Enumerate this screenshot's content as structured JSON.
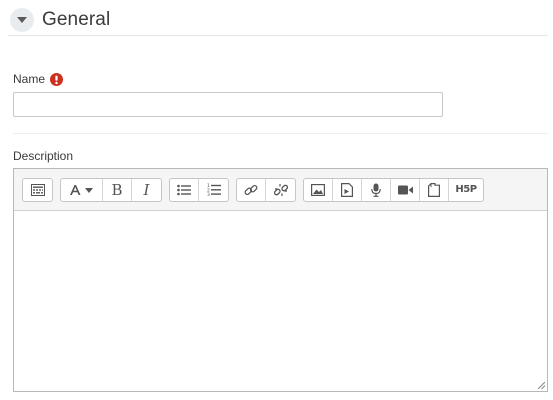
{
  "section": {
    "title": "General",
    "toggle_icon": "chevron-down-icon"
  },
  "fields": {
    "name": {
      "label": "Name",
      "value": "",
      "required": true,
      "required_icon": "exclamation-circle-icon",
      "required_color": "#ca3120"
    },
    "description": {
      "label": "Description",
      "value": ""
    }
  },
  "toolbar": {
    "groups": [
      [
        "toolbar-toggle-icon"
      ],
      [
        "font-style-icon",
        "bold-icon",
        "italic-icon"
      ],
      [
        "unordered-list-icon",
        "ordered-list-icon"
      ],
      [
        "link-icon",
        "unlink-icon"
      ],
      [
        "image-icon",
        "media-icon",
        "record-audio-icon",
        "record-video-icon",
        "manage-files-icon",
        "h5p-icon"
      ]
    ],
    "bold_glyph": "B",
    "italic_glyph": "I",
    "h5p_label": "H5P"
  },
  "colors": {
    "icon": "#555555",
    "required": "#ca3120",
    "border": "#c6c6c6"
  }
}
